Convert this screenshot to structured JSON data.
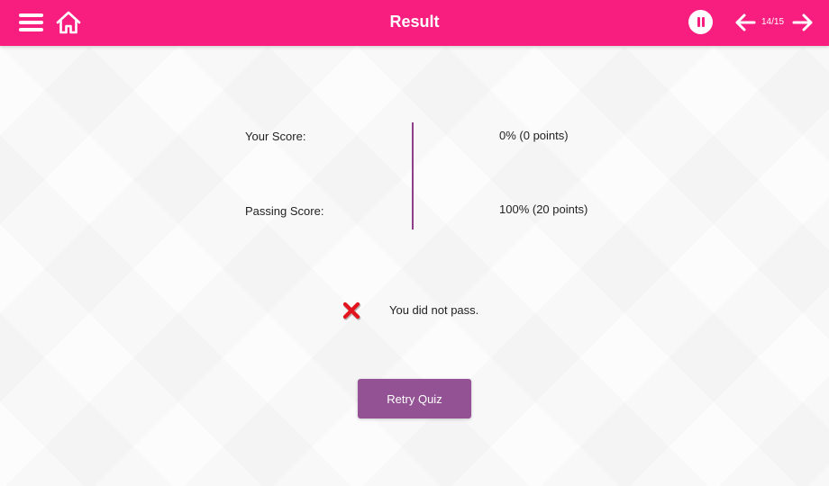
{
  "header": {
    "title": "Result",
    "page_counter": "14/15",
    "menu_icon": "hamburger-menu-icon",
    "home_icon": "home-icon",
    "pause_icon": "pause-icon",
    "prev_icon": "arrow-left-icon",
    "next_icon": "arrow-right-icon",
    "background_color": "#f81e7f"
  },
  "result": {
    "your_score_label": "Your Score:",
    "your_score_value": "0% (0 points)",
    "passing_score_label": "Passing Score:",
    "passing_score_value": "100% (20 points)",
    "status_icon": "red-x-icon",
    "status_message": "You did not pass.",
    "divider_color": "#8e3f8a"
  },
  "actions": {
    "retry_label": "Retry Quiz",
    "retry_color": "#925293"
  }
}
